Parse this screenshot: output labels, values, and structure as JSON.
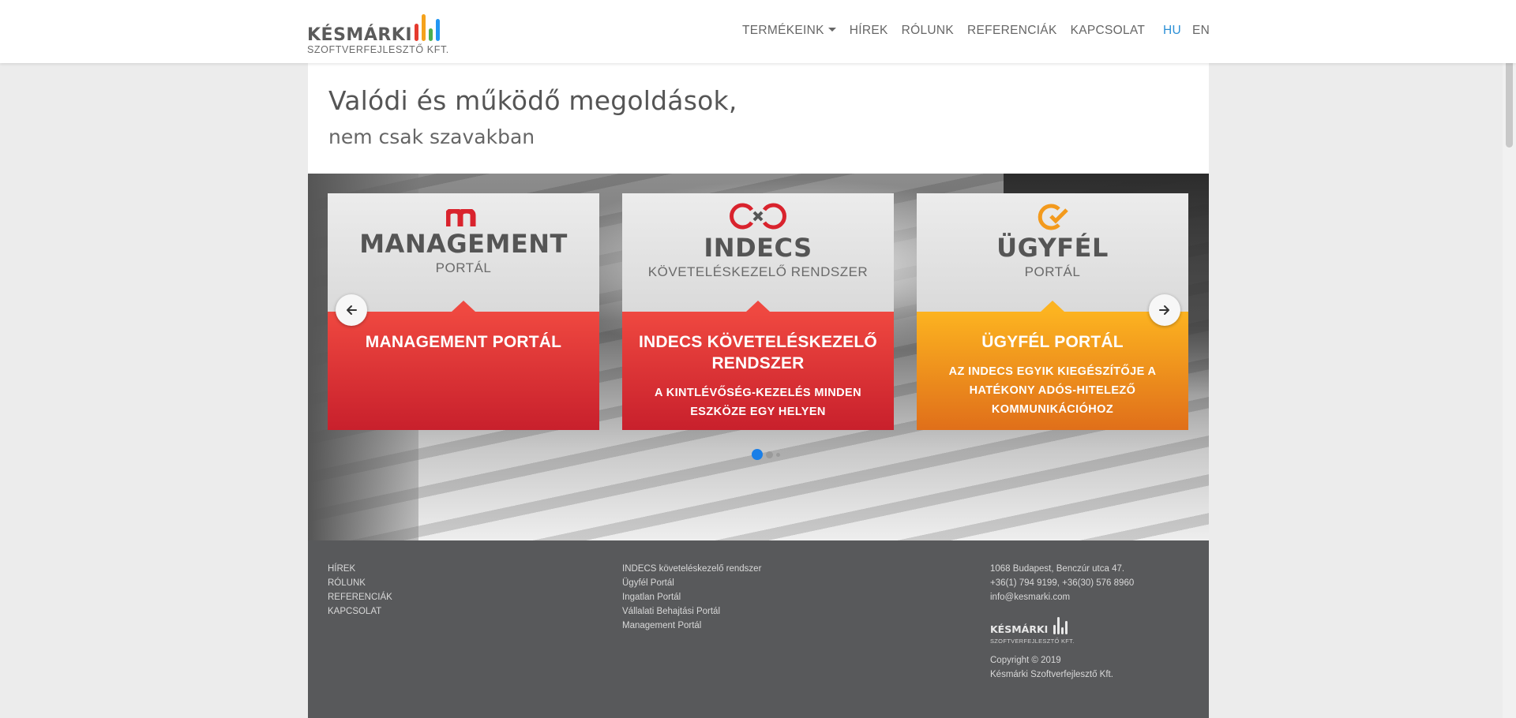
{
  "header": {
    "logo": {
      "name": "KÉSMÁRKI",
      "subtitle": "SZOFTVERFEJLESZTŐ KFT."
    },
    "nav": [
      "TERMÉKEINK",
      "HÍREK",
      "RÓLUNK",
      "REFERENCIÁK",
      "KAPCSOLAT"
    ],
    "languages": {
      "active": "HU",
      "other": "EN"
    },
    "colors": {
      "active_lang": "#2a8fd6"
    }
  },
  "intro": {
    "title": "Valódi és működő megoldások,",
    "subtitle": "nem csak szavakban"
  },
  "slider": {
    "cards": [
      {
        "brand_main": "MANAGEMENT",
        "brand_sub": "PORTÁL",
        "title": "MANAGEMENT PORTÁL",
        "description": "",
        "color": "#e4343a"
      },
      {
        "brand_main": "INDECS",
        "brand_sub": "KÖVETELÉSKEZELŐ RENDSZER",
        "title": "INDECS KÖVETELÉSKEZELŐ RENDSZER",
        "description": "A KINTLÉVŐSÉG-KEZELÉS MINDEN ESZKÖZE EGY HELYEN",
        "color": "#e4343a"
      },
      {
        "brand_main": "ÜGYFÉL",
        "brand_sub": "PORTÁL",
        "title": "ÜGYFÉL PORTÁL",
        "description": "AZ INDECS EGYIK KIEGÉSZÍTŐJE A HATÉKONY ADÓS-HITELEZŐ KOMMUNIKÁCIÓHOZ",
        "color": "#f39a1d"
      }
    ],
    "prev_icon": "arrow-left-icon",
    "next_icon": "arrow-right-icon",
    "page_count": 3,
    "active_page": 1,
    "colors": {
      "active_dot": "#1a7fe8"
    }
  },
  "footer": {
    "links_left": [
      "HÍREK",
      "RÓLUNK",
      "REFERENCIÁK",
      "KAPCSOLAT"
    ],
    "links_products": [
      "INDECS követeléskezelő rendszer",
      "Ügyfél Portál",
      "Ingatlan Portál",
      "Vállalati Behajtási Portál",
      "Management Portál"
    ],
    "address": "1068 Budapest, Benczúr utca 47.",
    "phones": "+36(1) 794 9199, +36(30) 576 8960",
    "email": "info@kesmarki.com",
    "logo": {
      "name": "KÉSMÁRKI",
      "subtitle": "SZOFTVERFEJLESZTŐ KFT."
    },
    "copyright": "Copyright © 2019",
    "company": "Késmárki Szoftverfejlesztő Kft."
  }
}
